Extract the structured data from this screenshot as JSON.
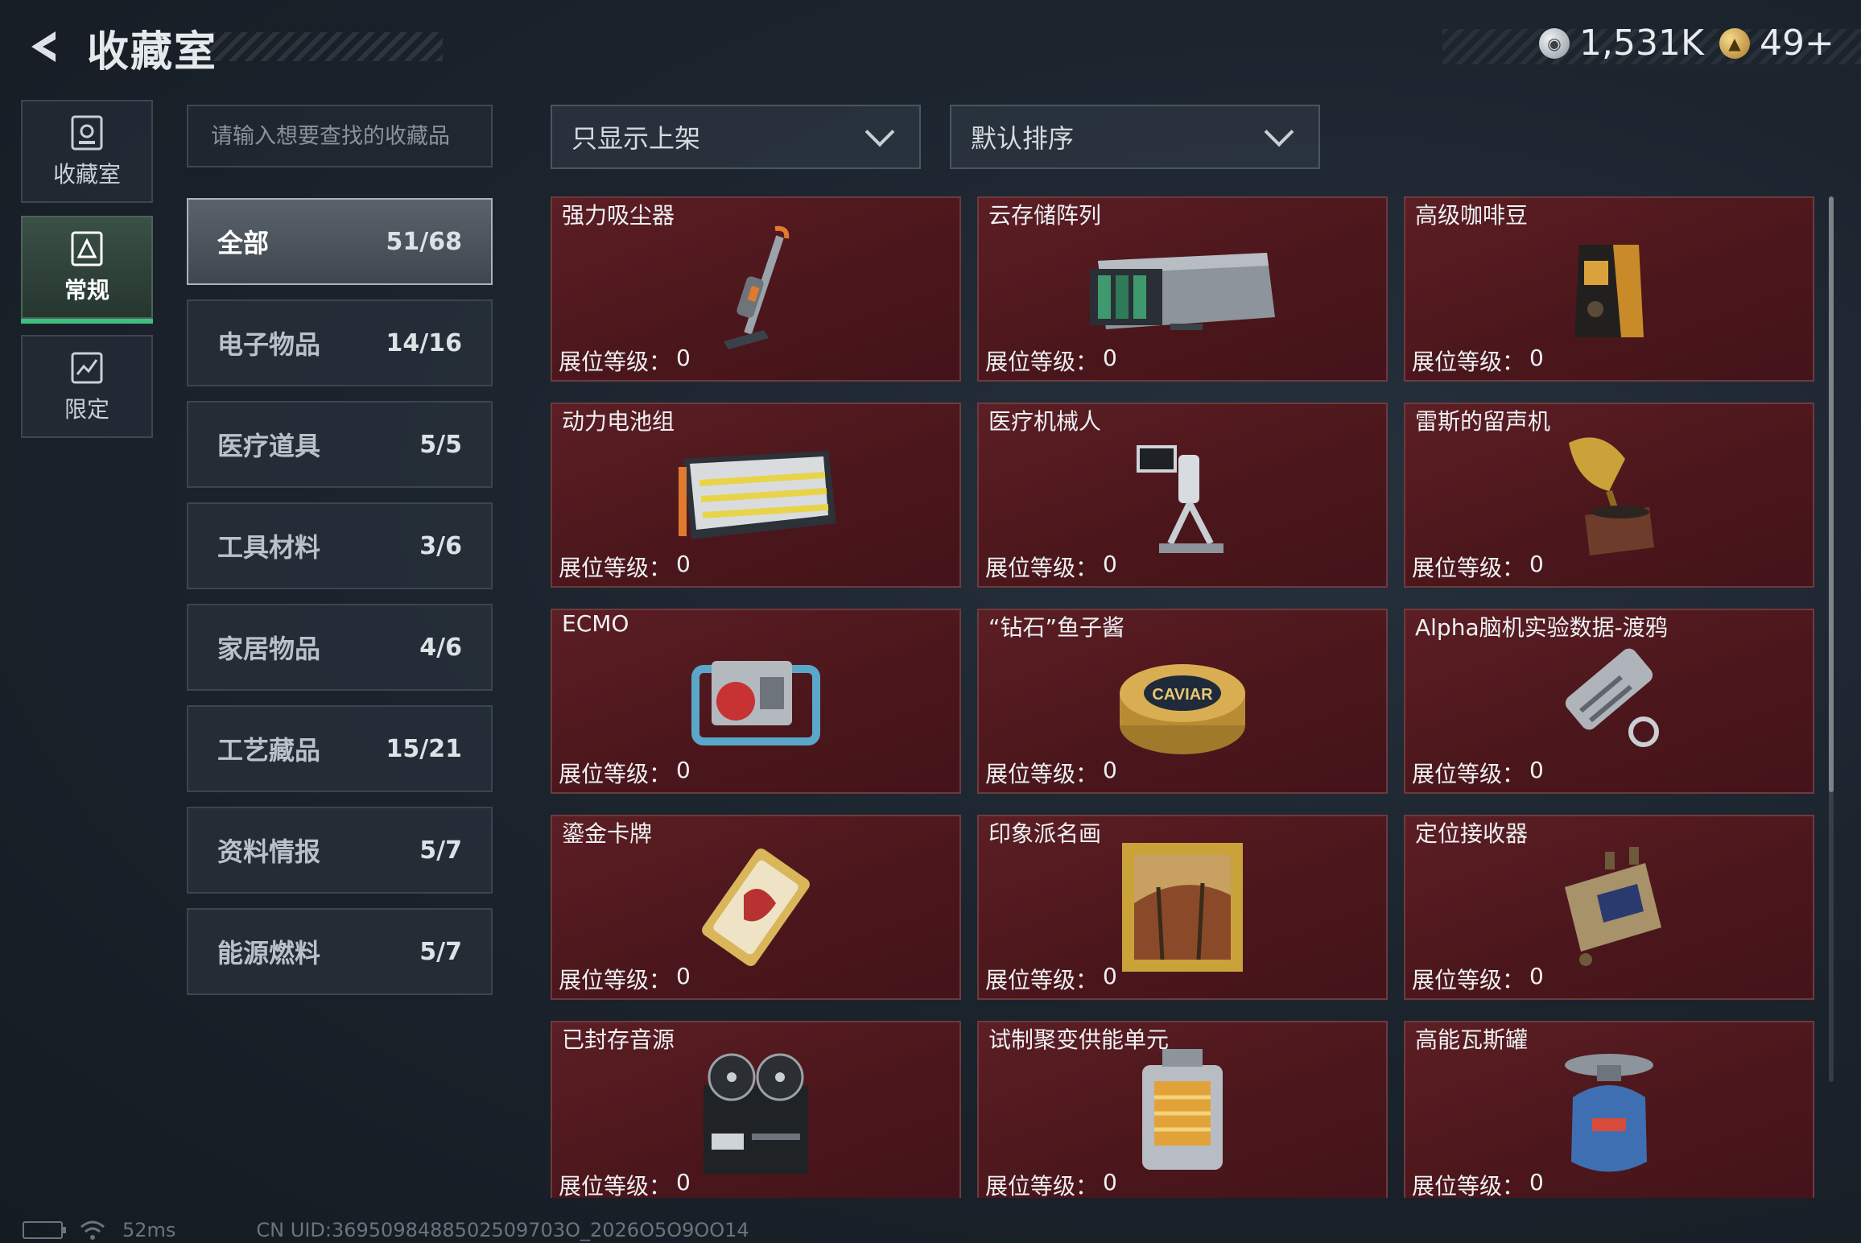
{
  "header": {
    "title": "收藏室",
    "currencies": [
      {
        "icon": "silver-coin-icon",
        "value": "1,531K"
      },
      {
        "icon": "gold-coin-icon",
        "value": "49+"
      }
    ]
  },
  "side_tabs": [
    {
      "icon": "collection-room-icon",
      "label": "收藏室",
      "active": false
    },
    {
      "icon": "regular-icon",
      "label": "常规",
      "active": true
    },
    {
      "icon": "limited-icon",
      "label": "限定",
      "active": false
    }
  ],
  "search": {
    "placeholder": "请输入想要查找的收藏品"
  },
  "filters": {
    "display_filter": "只显示上架",
    "sort": "默认排序"
  },
  "categories": [
    {
      "name": "全部",
      "count": "51/68",
      "active": true
    },
    {
      "name": "电子物品",
      "count": "14/16"
    },
    {
      "name": "医疗道具",
      "count": "5/5"
    },
    {
      "name": "工具材料",
      "count": "3/6"
    },
    {
      "name": "家居物品",
      "count": "4/6"
    },
    {
      "name": "工艺藏品",
      "count": "15/21"
    },
    {
      "name": "资料情报",
      "count": "5/7"
    },
    {
      "name": "能源燃料",
      "count": "5/7"
    }
  ],
  "level_label": "展位等级：",
  "items": [
    {
      "name": "强力吸尘器",
      "level": "0",
      "icon": "vacuum-cleaner-icon"
    },
    {
      "name": "云存储阵列",
      "level": "0",
      "icon": "storage-array-icon"
    },
    {
      "name": "高级咖啡豆",
      "level": "0",
      "icon": "coffee-bag-icon"
    },
    {
      "name": "动力电池组",
      "level": "0",
      "icon": "battery-pack-icon"
    },
    {
      "name": "医疗机械人",
      "level": "0",
      "icon": "medical-robot-icon"
    },
    {
      "name": "雷斯的留声机",
      "level": "0",
      "icon": "gramophone-icon"
    },
    {
      "name": "ECMO",
      "level": "0",
      "icon": "ecmo-machine-icon"
    },
    {
      "name": "“钻石”鱼子酱",
      "level": "0",
      "icon": "caviar-tin-icon"
    },
    {
      "name": "Alpha脑机实验数据-渡鸦",
      "level": "0",
      "icon": "data-drive-icon"
    },
    {
      "name": "鎏金卡牌",
      "level": "0",
      "icon": "gold-card-icon"
    },
    {
      "name": "印象派名画",
      "level": "0",
      "icon": "framed-painting-icon"
    },
    {
      "name": "定位接收器",
      "level": "0",
      "icon": "receiver-device-icon"
    },
    {
      "name": "已封存音源",
      "level": "0",
      "icon": "reel-recorder-icon"
    },
    {
      "name": "试制聚变供能单元",
      "level": "0",
      "icon": "fusion-unit-icon"
    },
    {
      "name": "高能瓦斯罐",
      "level": "0",
      "icon": "gas-canister-icon"
    }
  ],
  "caviar_label": "CAVIAR",
  "footer": {
    "ping": "52ms",
    "uid": "CN UID:3695098488502509703O_2026O5O9OO14"
  }
}
